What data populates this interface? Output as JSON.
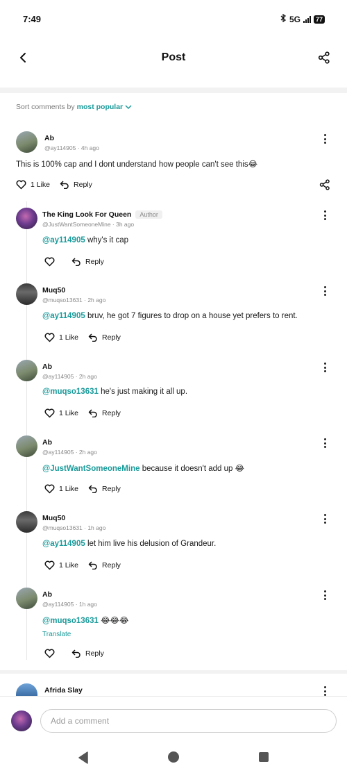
{
  "status_bar": {
    "time": "7:49",
    "network": "5G",
    "battery": "77"
  },
  "header": {
    "title": "Post"
  },
  "sort": {
    "label": "Sort comments by",
    "value": "most popular"
  },
  "comments": [
    {
      "name": "Ab",
      "meta": "@ay114905 · 4h ago",
      "mention": "",
      "text": "This is 100% cap and I dont understand how people can't see this😂",
      "like_label": "1 Like",
      "reply_label": "Reply"
    },
    {
      "name": "The King Look For Queen",
      "badge": "Author",
      "meta": "@JustWantSomeoneMine · 3h ago",
      "mention": "@ay114905",
      "text": " why's it cap",
      "like_label": "",
      "reply_label": "Reply"
    },
    {
      "name": "Muq50",
      "meta": "@muqso13631 · 2h ago",
      "mention": "@ay114905",
      "text": " bruv, he got 7 figures to drop on a house yet prefers to rent.",
      "like_label": "1 Like",
      "reply_label": "Reply"
    },
    {
      "name": "Ab",
      "meta": "@ay114905 · 2h ago",
      "mention": "@muqso13631",
      "text": " he's just making it all up.",
      "like_label": "1 Like",
      "reply_label": "Reply"
    },
    {
      "name": "Ab",
      "meta": "@ay114905 · 2h ago",
      "mention": "@JustWantSomeoneMine",
      "text": " because it doesn't add up 😂",
      "like_label": "1 Like",
      "reply_label": "Reply"
    },
    {
      "name": "Muq50",
      "meta": "@muqso13631 · 1h ago",
      "mention": "@ay114905",
      "text": " let him live his delusion of Grandeur.",
      "like_label": "1 Like",
      "reply_label": "Reply"
    },
    {
      "name": "Ab",
      "meta": "@ay114905 · 1h ago",
      "mention": "@muqso13631",
      "text": " 😂😂😂",
      "translate": "Translate",
      "like_label": "",
      "reply_label": "Reply"
    },
    {
      "name": "Afrida Slay"
    }
  ],
  "composer": {
    "placeholder": "Add a comment"
  },
  "colors": {
    "accent": "#1a9a9a",
    "text": "#1a1a1a",
    "muted": "#888888"
  }
}
